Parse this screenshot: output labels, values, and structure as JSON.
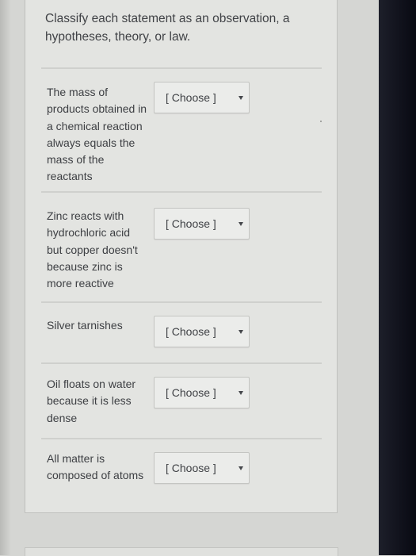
{
  "question": {
    "text": "Classify each statement as an observation, a hypotheses, theory, or law."
  },
  "items": [
    {
      "statement": "The mass of products obtained in a chemical reaction always equals the mass of the reactants",
      "selected": "[ Choose ]"
    },
    {
      "statement": "Zinc reacts with hydrochloric acid but copper doesn't because zinc is more reactive",
      "selected": "[ Choose ]"
    },
    {
      "statement": "Silver tarnishes",
      "selected": "[ Choose ]"
    },
    {
      "statement": "Oil floats on water because it is less dense",
      "selected": "[ Choose ]"
    },
    {
      "statement": "All matter is composed of atoms",
      "selected": "[ Choose ]"
    }
  ]
}
